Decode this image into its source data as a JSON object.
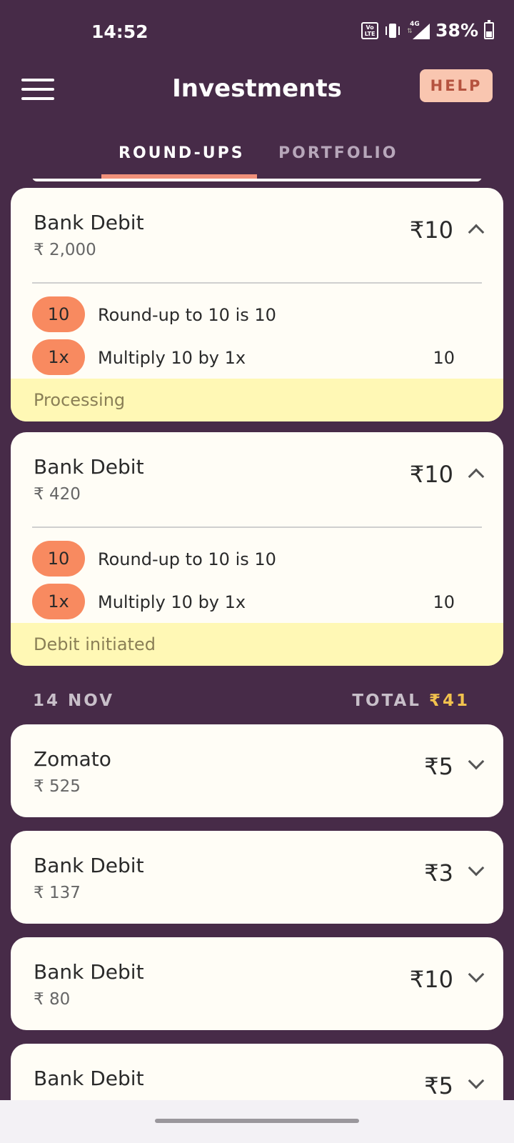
{
  "status_bar": {
    "time": "14:52",
    "volte_label": "Vo LTE",
    "network_label": "4G",
    "battery": "38%",
    "icons": [
      "volte-icon",
      "vibrate-icon",
      "signal-icon",
      "battery-icon"
    ]
  },
  "app_bar": {
    "title": "Investments",
    "help_label": "HELP",
    "menu_icon": "menu-icon"
  },
  "tabs": [
    {
      "label": "ROUND-UPS",
      "active": true
    },
    {
      "label": "PORTFOLIO",
      "active": false
    }
  ],
  "expanded_cards": [
    {
      "title": "Bank Debit",
      "sub": "₹ 2,000",
      "amount": "₹10",
      "rows": [
        {
          "pill": "10",
          "text": "Round-up to 10 is 10",
          "value": ""
        },
        {
          "pill": "1x",
          "text": "Multiply 10 by 1x",
          "value": "10"
        }
      ],
      "status": "Processing"
    },
    {
      "title": "Bank Debit",
      "sub": "₹ 420",
      "amount": "₹10",
      "rows": [
        {
          "pill": "10",
          "text": "Round-up to 10 is 10",
          "value": ""
        },
        {
          "pill": "1x",
          "text": "Multiply 10 by 1x",
          "value": "10"
        }
      ],
      "status": "Debit initiated"
    }
  ],
  "group": {
    "date": "14 NOV",
    "total_label": "TOTAL",
    "total_amount": "₹41"
  },
  "collapsed_cards": [
    {
      "title": "Zomato",
      "sub": "₹ 525",
      "amount": "₹5"
    },
    {
      "title": "Bank Debit",
      "sub": "₹ 137",
      "amount": "₹3"
    },
    {
      "title": "Bank Debit",
      "sub": "₹ 80",
      "amount": "₹10"
    },
    {
      "title": "Bank Debit",
      "sub": "",
      "amount": "₹5"
    }
  ],
  "colors": {
    "background": "#472b48",
    "card": "#fffdf6",
    "pill": "#f88a60",
    "status_strip": "#fff8b5",
    "accent_tab": "#f0907a",
    "total_amount": "#f2c24e",
    "help_bg": "#f9c6b0"
  }
}
